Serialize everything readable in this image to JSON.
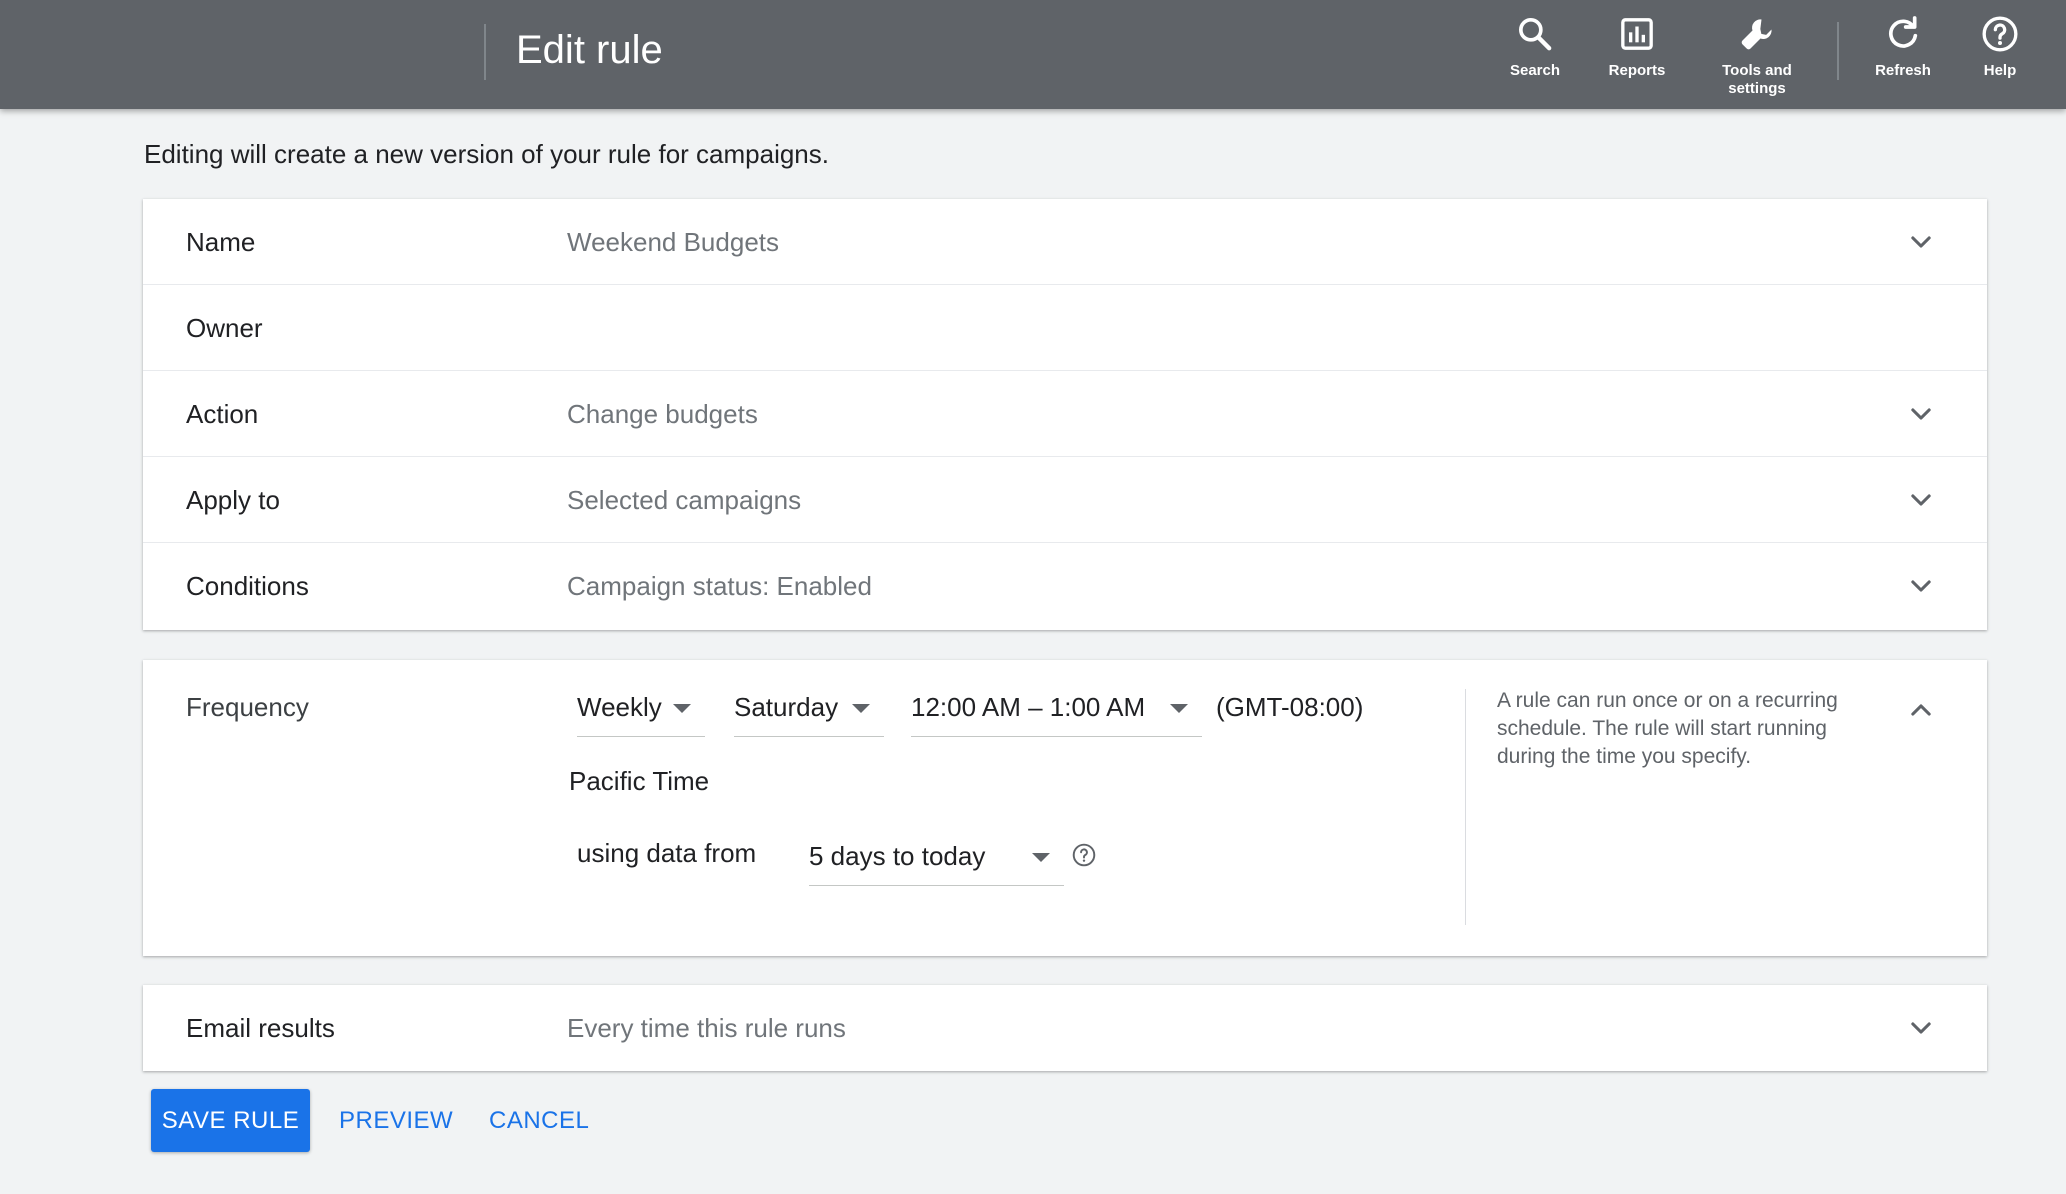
{
  "header": {
    "title": "Edit rule",
    "buttons": [
      {
        "label": "Search",
        "icon": "search-icon"
      },
      {
        "label": "Reports",
        "icon": "reports-icon"
      },
      {
        "label": "Tools and\nsettings",
        "icon": "wrench-icon"
      },
      {
        "label": "Refresh",
        "icon": "refresh-icon"
      },
      {
        "label": "Help",
        "icon": "help-icon"
      }
    ]
  },
  "intro": "Editing will create a new version of your rule for campaigns.",
  "rules": [
    {
      "label": "Name",
      "value": "Weekend Budgets"
    },
    {
      "label": "Owner",
      "value": ""
    },
    {
      "label": "Action",
      "value": "Change budgets"
    },
    {
      "label": "Apply to",
      "value": "Selected campaigns"
    },
    {
      "label": "Conditions",
      "value": "Campaign status: Enabled"
    }
  ],
  "frequency": {
    "label": "Frequency",
    "period": "Weekly",
    "day": "Saturday",
    "time": "12:00 AM – 1:00 AM",
    "timezone_offset": "(GMT-08:00)",
    "timezone_name": "Pacific Time",
    "data_label": "using data from",
    "data_range": "5 days to today",
    "help": "A rule can run once or on a recurring schedule. The rule will start running during the time you specify."
  },
  "email": {
    "label": "Email results",
    "value": "Every time this rule runs"
  },
  "actions": {
    "save": "SAVE RULE",
    "preview": "PREVIEW",
    "cancel": "CANCEL"
  },
  "colors": {
    "header_bg": "#5f6368",
    "accent": "#1a73e8",
    "page_bg": "#f1f3f4"
  }
}
